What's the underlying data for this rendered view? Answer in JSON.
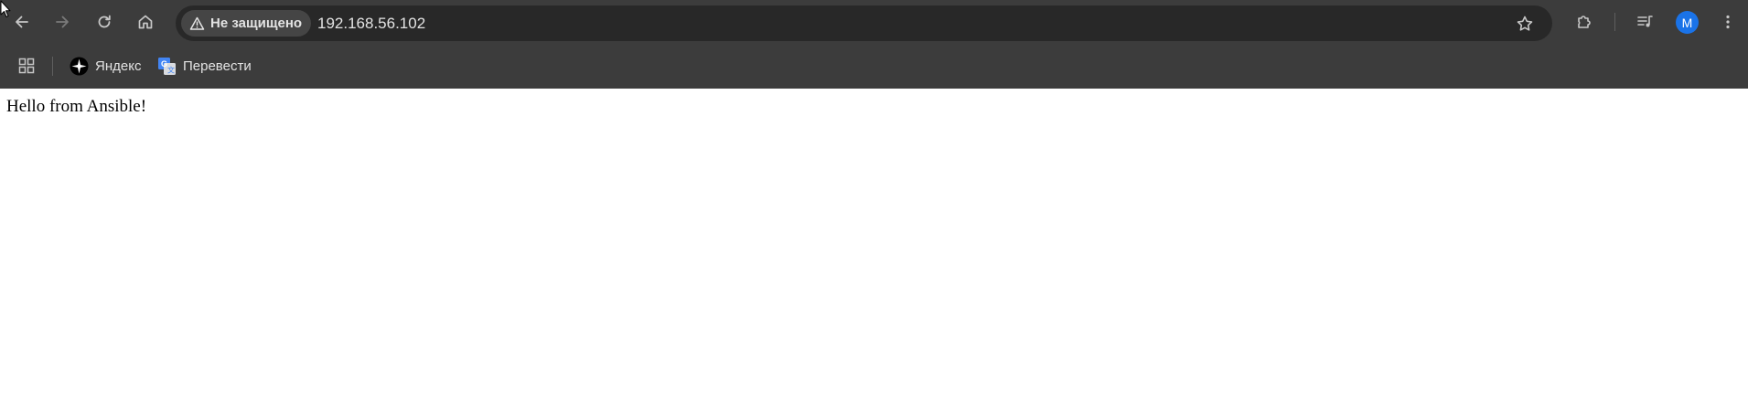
{
  "toolbar": {
    "back_icon": "arrow-left-icon",
    "forward_icon": "arrow-right-icon",
    "reload_icon": "reload-icon",
    "home_icon": "home-icon"
  },
  "omnibox": {
    "security_label": "Не защищено",
    "security_icon": "warning-triangle-icon",
    "url": "192.168.56.102",
    "bookmark_icon": "star-outline-icon"
  },
  "right_toolbar": {
    "extensions_icon": "puzzle-icon",
    "media_icon": "media-queue-icon",
    "profile_initial": "M",
    "profile_color": "#1a73e8",
    "menu_icon": "kebab-menu-icon"
  },
  "bookmarks": {
    "apps_icon": "apps-grid-icon",
    "items": [
      {
        "label": "Яндекс",
        "icon": "yandex-icon"
      },
      {
        "label": "Перевести",
        "icon": "google-translate-icon"
      }
    ]
  },
  "page": {
    "text": "Hello from Ansible!"
  },
  "colors": {
    "toolbar_bg": "#3c3c3c",
    "omnibox_bg": "#282828",
    "chip_bg": "#454545",
    "text_light": "#e3e3e3",
    "page_bg": "#ffffff"
  }
}
